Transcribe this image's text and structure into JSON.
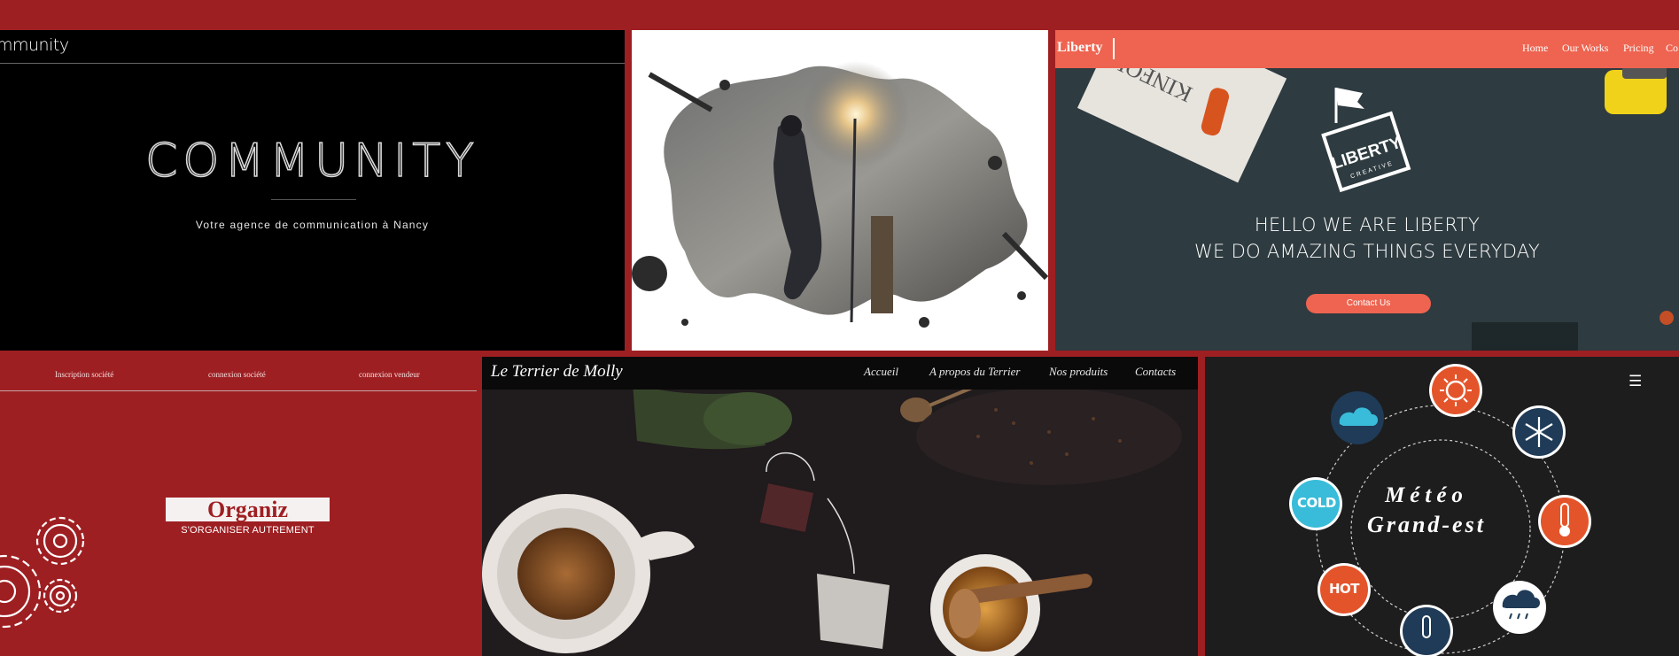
{
  "community": {
    "logo_small": "mmunity",
    "title": "COMMUNITY",
    "tagline": "Votre agence de communication à Nancy"
  },
  "liberty": {
    "brand": "Liberty",
    "nav": [
      "Home",
      "Our Works",
      "Pricing",
      "Co"
    ],
    "badge_text": "LIBERTY",
    "badge_sub": "CREATIVE",
    "hero_line1": "HELLO WE ARE LIBERTY",
    "hero_line2": "WE DO AMAZING THINGS EVERYDAY",
    "cta": "Contact Us",
    "book_text": "KINFOLK",
    "accent": "#ee6450"
  },
  "organiz": {
    "nav": [
      "Inscription société",
      "connexion société",
      "connexion vendeur"
    ],
    "logo": "Organiz",
    "subtitle": "S'ORGANISER AUTREMENT",
    "accent": "#9e1f22"
  },
  "molly": {
    "brand": "Le Terrier de Molly",
    "nav": [
      "Accueil",
      "A propos du Terrier",
      "Nos produits",
      "Contacts"
    ]
  },
  "meteo": {
    "title_line1": "Météo",
    "title_line2": "Grand-est",
    "cold_label": "COLD",
    "hot_label": "HOT",
    "menu_icon": "hamburger-icon"
  }
}
